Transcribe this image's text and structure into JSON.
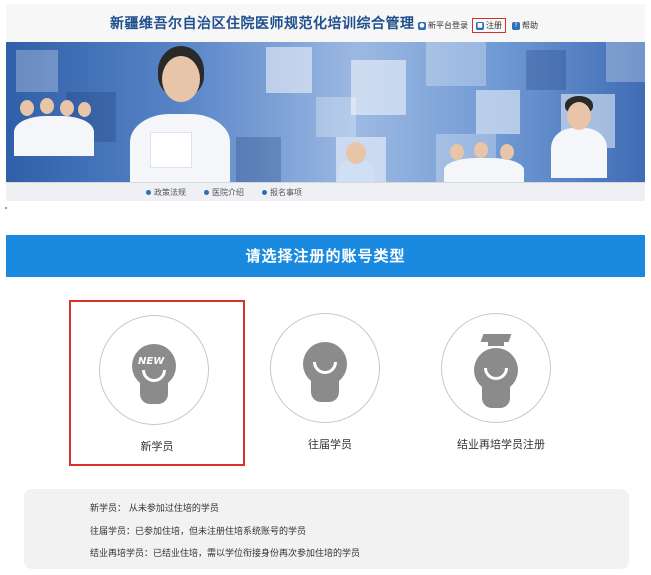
{
  "portal": {
    "title": "新疆维吾尔自治区住院医师规范化培训综合管理",
    "top_links": [
      {
        "label": "新平台登录",
        "icon": "user-icon"
      },
      {
        "label": "注册",
        "icon": "lock-icon"
      },
      {
        "label": "帮助",
        "icon": "help-icon"
      }
    ],
    "subnav": [
      "政策法规",
      "医院介绍",
      "报名事项"
    ]
  },
  "register": {
    "header": "请选择注册的账号类型",
    "options": [
      {
        "label": "新学员",
        "badge": "NEW",
        "icon": "new-student-icon"
      },
      {
        "label": "往届学员",
        "icon": "former-student-icon"
      },
      {
        "label": "结业再培学员注册",
        "icon": "graduate-cap-icon"
      }
    ],
    "notes": [
      "新学员： 从未参加过住培的学员",
      "往届学员：已参加住培，但未注册住培系统账号的学员",
      "结业再培学员：已结业住培，需以学位衔接身份再次参加住培的学员"
    ]
  },
  "colors": {
    "accent": "#1a8ae0",
    "selected_border": "#d9302b",
    "icon_gray": "#8b8b8b"
  }
}
